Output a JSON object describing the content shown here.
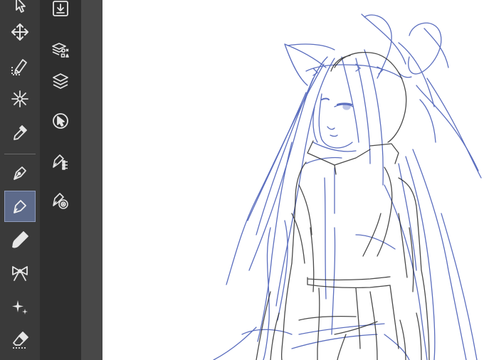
{
  "app": {
    "active_tool": "pen"
  },
  "toolbar": {
    "items": [
      {
        "name": "select-arrow-tool",
        "icon": "arrow-cursor-icon"
      },
      {
        "name": "move-tool",
        "icon": "move-cross-arrows-icon"
      },
      {
        "name": "selection-pen-tool",
        "icon": "selection-pen-icon"
      },
      {
        "name": "auto-select-tool",
        "icon": "magic-wand-sparkle-icon"
      },
      {
        "name": "eyedropper-tool",
        "icon": "eyedropper-icon"
      },
      {
        "name": "pen-tool",
        "icon": "pen-nib-icon"
      },
      {
        "name": "pencil-tool",
        "icon": "pencil-icon",
        "active": true
      },
      {
        "name": "brush-tool",
        "icon": "brush-icon"
      },
      {
        "name": "decoration-tool",
        "icon": "ribbon-bow-icon"
      },
      {
        "name": "airbrush-tool",
        "icon": "sparkle-stars-icon"
      },
      {
        "name": "eraser-tool",
        "icon": "eraser-icon"
      }
    ]
  },
  "subtoolbar": {
    "items": [
      {
        "name": "import-button",
        "icon": "import-download-icon"
      },
      {
        "name": "layer-property-button",
        "icon": "layers-shapes-icon"
      },
      {
        "name": "layer-list-button",
        "icon": "layers-stack-icon"
      },
      {
        "name": "reference-button",
        "icon": "circle-arrow-icon"
      },
      {
        "name": "vector-pen-options-button",
        "icon": "pen-options-icon"
      },
      {
        "name": "pen-settings-button",
        "icon": "pen-target-icon"
      }
    ]
  },
  "colors": {
    "toolbar_bg": "#3a3a3a",
    "subtoolbar_bg": "#2e2e2e",
    "active_tool_bg": "#5d6a8a",
    "icon_color": "#e6e6e6",
    "sketch_blue": "#4a5fb8",
    "sketch_dark": "#2a2a2a",
    "canvas_bg": "#ffffff"
  },
  "canvas": {
    "content": "sketch-illustration"
  }
}
